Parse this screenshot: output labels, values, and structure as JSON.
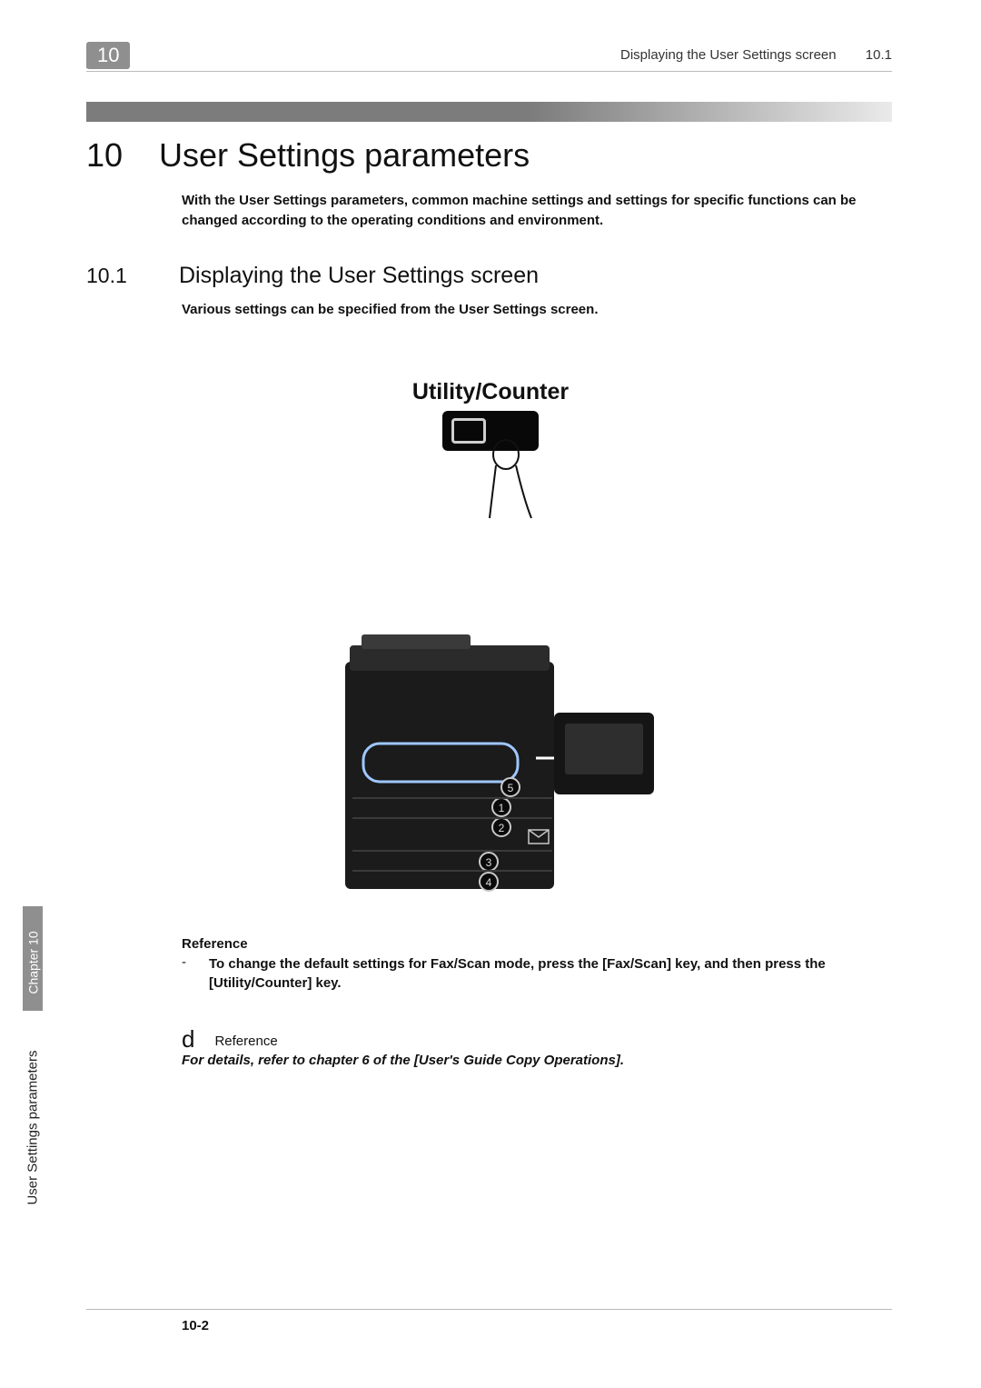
{
  "header": {
    "chapter_tag": "10",
    "running_head": "Displaying the User Settings screen",
    "running_head_num": "10.1"
  },
  "title": {
    "num": "10",
    "text": "User Settings parameters"
  },
  "intro": "With the User Settings parameters, common machine settings and settings for specific functions can be changed according to the operating conditions and environment.",
  "section": {
    "num": "10.1",
    "title": "Displaying the User Settings screen",
    "intro": "Various settings can be specified from the User Settings screen."
  },
  "key_label": "Utility/Counter",
  "reference": {
    "label": "Reference",
    "item1": "To change the default settings for Fax/Scan mode, press the [Fax/Scan] key, and then press the [Utility/Counter] key."
  },
  "d_reference": {
    "glyph": "d",
    "label": "Reference",
    "text": "For details, refer to chapter 6 of the [User's Guide Copy Operations]."
  },
  "side": {
    "chapter": "Chapter 10",
    "title": "User Settings parameters"
  },
  "footer": {
    "page": "10-2"
  }
}
